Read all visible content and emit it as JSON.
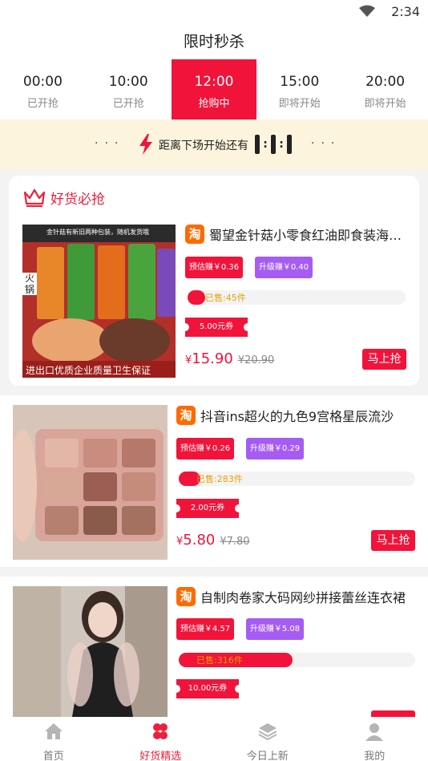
{
  "status_bar": {
    "time": "2:34"
  },
  "header": {
    "title": "限时秒杀"
  },
  "time_tabs": [
    {
      "time": "00:00",
      "status": "已开抢"
    },
    {
      "time": "10:00",
      "status": "已开抢"
    },
    {
      "time": "12:00",
      "status": "抢购中"
    },
    {
      "time": "15:00",
      "status": "即将开始"
    },
    {
      "time": "20:00",
      "status": "即将开始"
    }
  ],
  "countdown": {
    "label": "距离下场开始还有"
  },
  "featured_section": {
    "title": "好货必抢"
  },
  "products": [
    {
      "title": "蜀望金针菇小零食红油即食装海…",
      "estimate": "预估赚￥0.36",
      "upgrade": "升级赚￥0.40",
      "sold": "已售:45件",
      "sold_fraction": 0.08,
      "coupon": "5.00元券",
      "currency": "¥",
      "price": "15.90",
      "original_price": "¥20.90",
      "buy_label": "马上抢",
      "image_texts": [
        "金针菇有新旧两种包装，随机发货哦",
        "火锅",
        "进出口优质企业质量卫生保证"
      ]
    },
    {
      "title": "抖音ins超火的九色9宫格星辰流沙",
      "estimate": "预估赚￥0.26",
      "upgrade": "升级赚￥0.29",
      "sold": "已售:283件",
      "sold_fraction": 0.09,
      "coupon": "2.00元券",
      "currency": "¥",
      "price": "5.80",
      "original_price": "¥7.80",
      "buy_label": "马上抢"
    },
    {
      "title": "自制肉卷家大码网纱拼接蕾丝连衣裙",
      "estimate": "预估赚￥4.57",
      "upgrade": "升级赚￥5.08",
      "sold": "已售:316件",
      "sold_fraction": 0.48,
      "coupon": "10.00元券"
    }
  ],
  "bottom_nav": [
    {
      "label": "首页",
      "icon": "home-icon"
    },
    {
      "label": "好货精选",
      "icon": "clover-icon"
    },
    {
      "label": "今日上新",
      "icon": "layers-icon"
    },
    {
      "label": "我的",
      "icon": "user-icon"
    }
  ],
  "colors": {
    "accent": "#f2133a",
    "purple": "#a65cf3",
    "countdown_bg": "#fdf4dd",
    "taobao": "#ff6a00"
  }
}
